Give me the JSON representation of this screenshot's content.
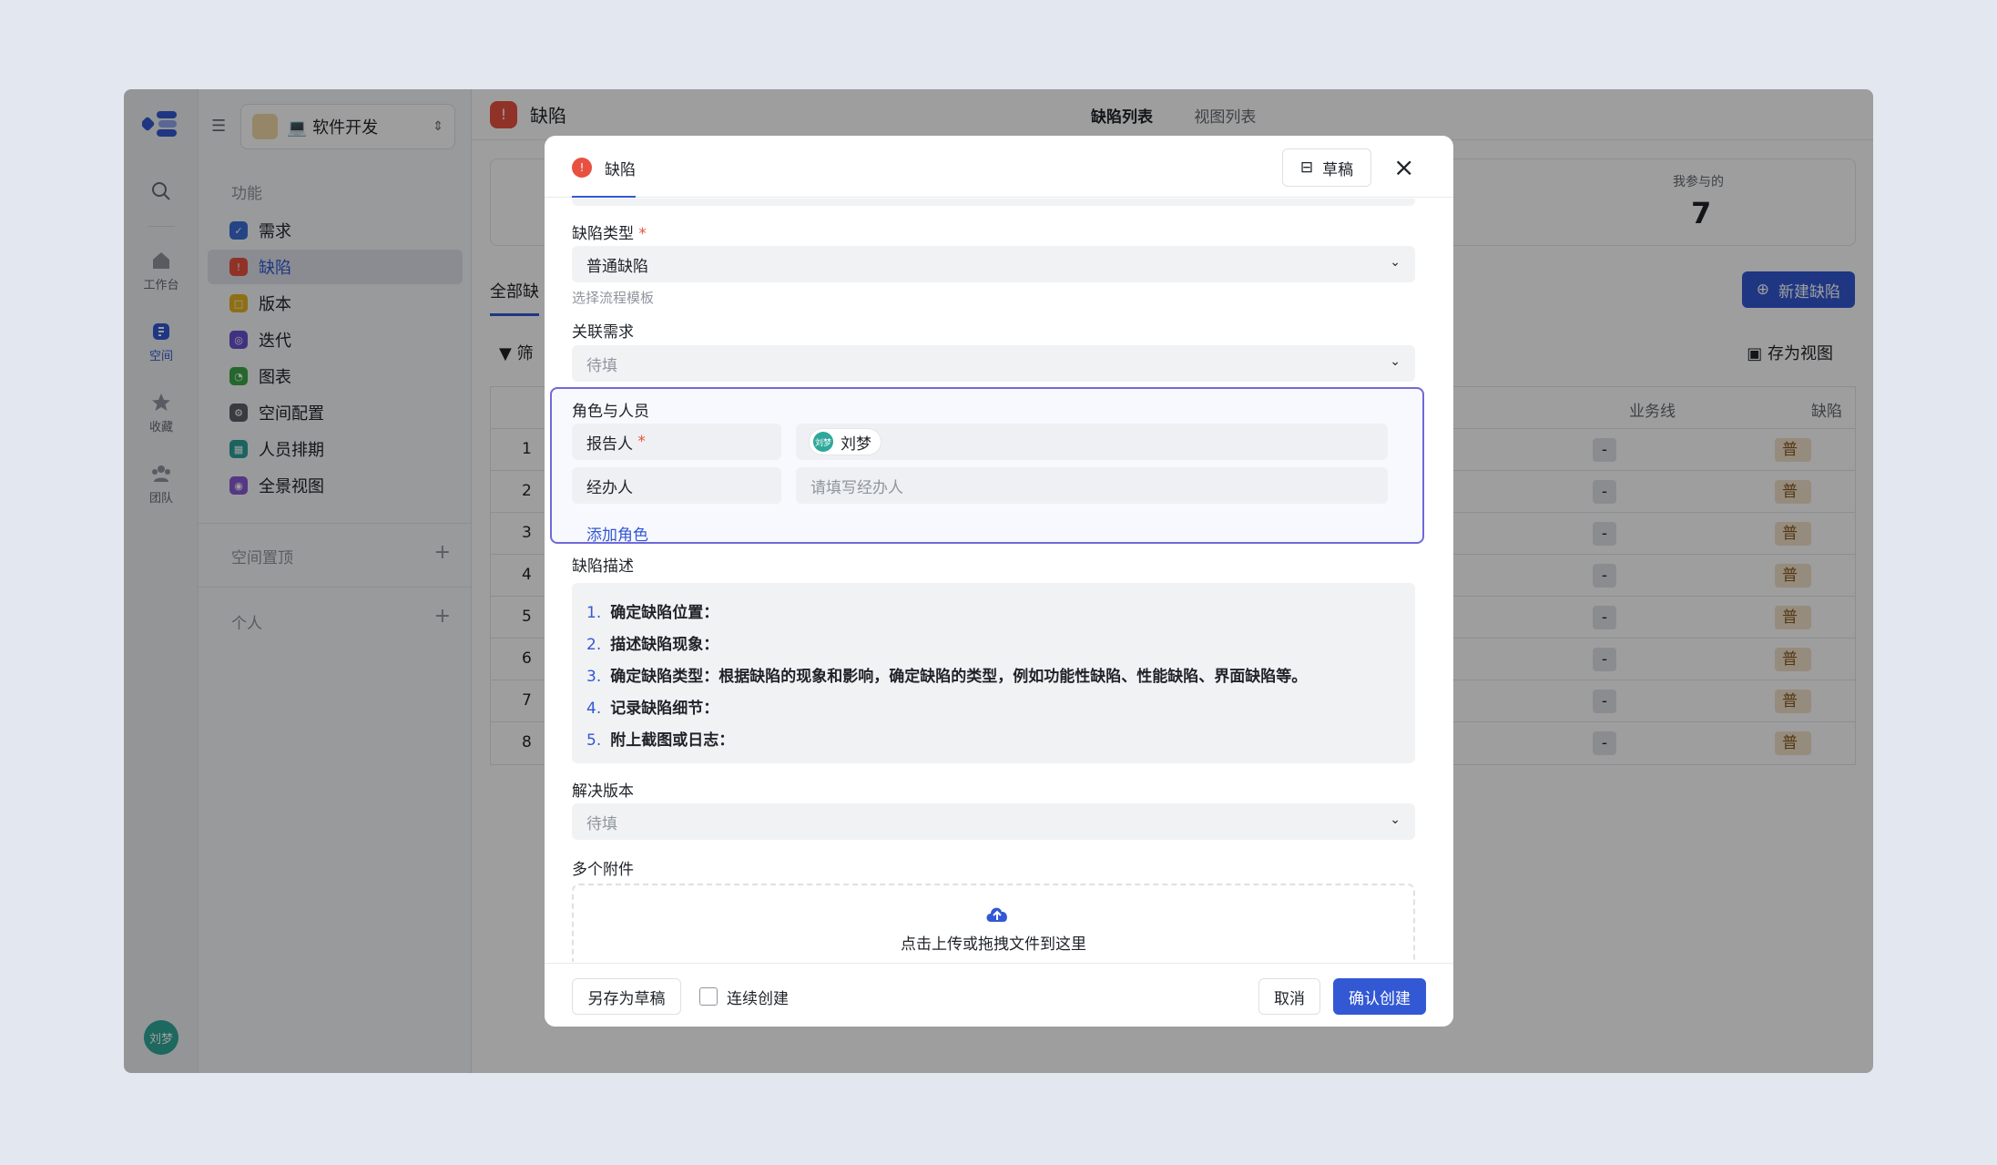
{
  "rail": {
    "items": [
      {
        "label": ""
      },
      {
        "label": "工作台"
      },
      {
        "label": "空间"
      },
      {
        "label": "收藏"
      },
      {
        "label": "团队"
      }
    ],
    "avatar": "刘梦"
  },
  "sidebar": {
    "project": "💻 软件开发",
    "section_feature": "功能",
    "items": [
      {
        "label": "需求",
        "color": "#3a6fd8"
      },
      {
        "label": "缺陷",
        "color": "#e8513f"
      },
      {
        "label": "版本",
        "color": "#e6b422"
      },
      {
        "label": "迭代",
        "color": "#6a4fd1"
      },
      {
        "label": "图表",
        "color": "#3aa64a"
      },
      {
        "label": "空间配置",
        "color": "#5b5f66"
      },
      {
        "label": "人员排期",
        "color": "#2aa198"
      },
      {
        "label": "全景视图",
        "color": "#8a5bd4"
      }
    ],
    "section_pin": "空间置顶",
    "section_personal": "个人"
  },
  "header": {
    "title": "缺陷",
    "tabs": [
      "缺陷列表",
      "视图列表"
    ]
  },
  "stats": {
    "label": "我参与的",
    "value": "7"
  },
  "list": {
    "tab": "全部缺",
    "new_button": "新建缺陷",
    "filter": "筛",
    "save_view": "存为视图",
    "col_business": "业务线",
    "col_defect": "缺陷",
    "rows": [
      "1",
      "2",
      "3",
      "4",
      "5",
      "6",
      "7",
      "8"
    ],
    "dash": "-",
    "tag": "普"
  },
  "modal": {
    "tab": "缺陷",
    "draft": "草稿",
    "type_label": "缺陷类型",
    "type_value": "普通缺陷",
    "type_hint": "选择流程模板",
    "req_label": "关联需求",
    "req_placeholder": "待填",
    "roles_label": "角色与人员",
    "reporter_label": "报告人",
    "reporter_value": "刘梦",
    "reporter_initials": "刘梦",
    "handler_label": "经办人",
    "handler_placeholder": "请填写经办人",
    "add_role": "添加角色",
    "desc_label": "缺陷描述",
    "desc_items": [
      {
        "num": "1.",
        "text": "确定缺陷位置："
      },
      {
        "num": "2.",
        "text": "描述缺陷现象："
      },
      {
        "num": "3.",
        "text": "确定缺陷类型：根据缺陷的现象和影响，确定缺陷的类型，例如功能性缺陷、性能缺陷、界面缺陷等。"
      },
      {
        "num": "4.",
        "text": "记录缺陷细节："
      },
      {
        "num": "5.",
        "text": "附上截图或日志："
      }
    ],
    "version_label": "解决版本",
    "version_placeholder": "待填",
    "attach_label": "多个附件",
    "upload_text": "点击上传或拖拽文件到这里",
    "save_draft": "另存为草稿",
    "continuous": "连续创建",
    "cancel": "取消",
    "confirm": "确认创建"
  }
}
